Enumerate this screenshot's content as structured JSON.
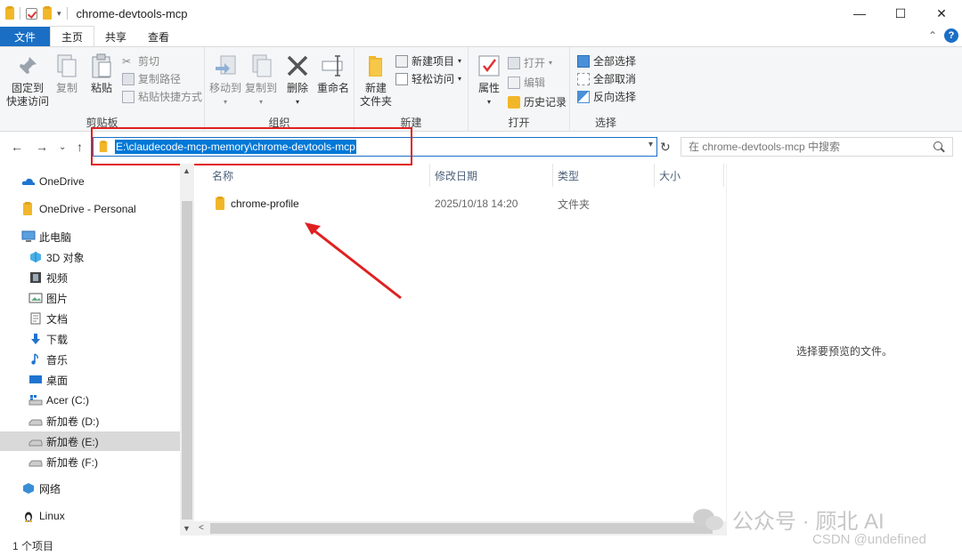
{
  "window": {
    "title": "chrome-devtools-mcp",
    "controls": {
      "minimize": "—",
      "maximize": "☐",
      "close": "✕"
    }
  },
  "tabs": {
    "file": "文件",
    "items": [
      "主页",
      "共享",
      "查看"
    ],
    "active": "主页"
  },
  "ribbon": {
    "clipboard": {
      "label": "剪贴板",
      "pin": "固定到\n快速访问",
      "pin_line1": "固定到",
      "pin_line2": "快速访问",
      "copy": "复制",
      "paste": "粘贴",
      "cut": "剪切",
      "copy_path": "复制路径",
      "paste_shortcut": "粘贴快捷方式"
    },
    "organize": {
      "label": "组织",
      "move_to": "移动到",
      "copy_to": "复制到",
      "delete": "删除",
      "rename": "重命名"
    },
    "new": {
      "label": "新建",
      "new_folder_line1": "新建",
      "new_folder_line2": "文件夹",
      "new_item": "新建项目",
      "easy_access": "轻松访问"
    },
    "open": {
      "label": "打开",
      "properties": "属性",
      "open": "打开",
      "edit": "编辑",
      "history": "历史记录"
    },
    "select": {
      "label": "选择",
      "select_all": "全部选择",
      "select_none": "全部取消",
      "invert": "反向选择"
    }
  },
  "address": {
    "path": "E:\\claudecode-mcp-memory\\chrome-devtools-mcp",
    "search_placeholder": "在 chrome-devtools-mcp 中搜索"
  },
  "nav": {
    "items": [
      {
        "label": "OneDrive",
        "icon": "cloud-icon"
      },
      {
        "label": "OneDrive - Personal",
        "icon": "folder-icon"
      },
      {
        "label": "此电脑",
        "icon": "computer-icon"
      },
      {
        "label": "3D 对象",
        "icon": "3d-objects-icon"
      },
      {
        "label": "视频",
        "icon": "video-icon"
      },
      {
        "label": "图片",
        "icon": "pictures-icon"
      },
      {
        "label": "文档",
        "icon": "documents-icon"
      },
      {
        "label": "下载",
        "icon": "download-icon"
      },
      {
        "label": "音乐",
        "icon": "music-icon"
      },
      {
        "label": "桌面",
        "icon": "desktop-icon"
      },
      {
        "label": "Acer (C:)",
        "icon": "drive-c-icon"
      },
      {
        "label": "新加卷 (D:)",
        "icon": "drive-icon"
      },
      {
        "label": "新加卷 (E:)",
        "icon": "drive-icon",
        "selected": true
      },
      {
        "label": "新加卷 (F:)",
        "icon": "drive-icon"
      },
      {
        "label": "网络",
        "icon": "network-icon"
      },
      {
        "label": "Linux",
        "icon": "linux-icon"
      }
    ]
  },
  "filelist": {
    "columns": [
      "名称",
      "修改日期",
      "类型",
      "大小"
    ],
    "rows": [
      {
        "name": "chrome-profile",
        "modified": "2025/10/18 14:20",
        "type": "文件夹",
        "size": ""
      }
    ]
  },
  "preview": {
    "empty_text": "选择要预览的文件。"
  },
  "status": {
    "count": "1 个项目"
  },
  "watermark": {
    "line1": "公众号 · 顾北 AI",
    "line2": "CSDN @undefined"
  },
  "colors": {
    "accent": "#1a6fc4",
    "selection": "#0078d7",
    "annotation": "#e02020",
    "folder": "#f2b729"
  }
}
